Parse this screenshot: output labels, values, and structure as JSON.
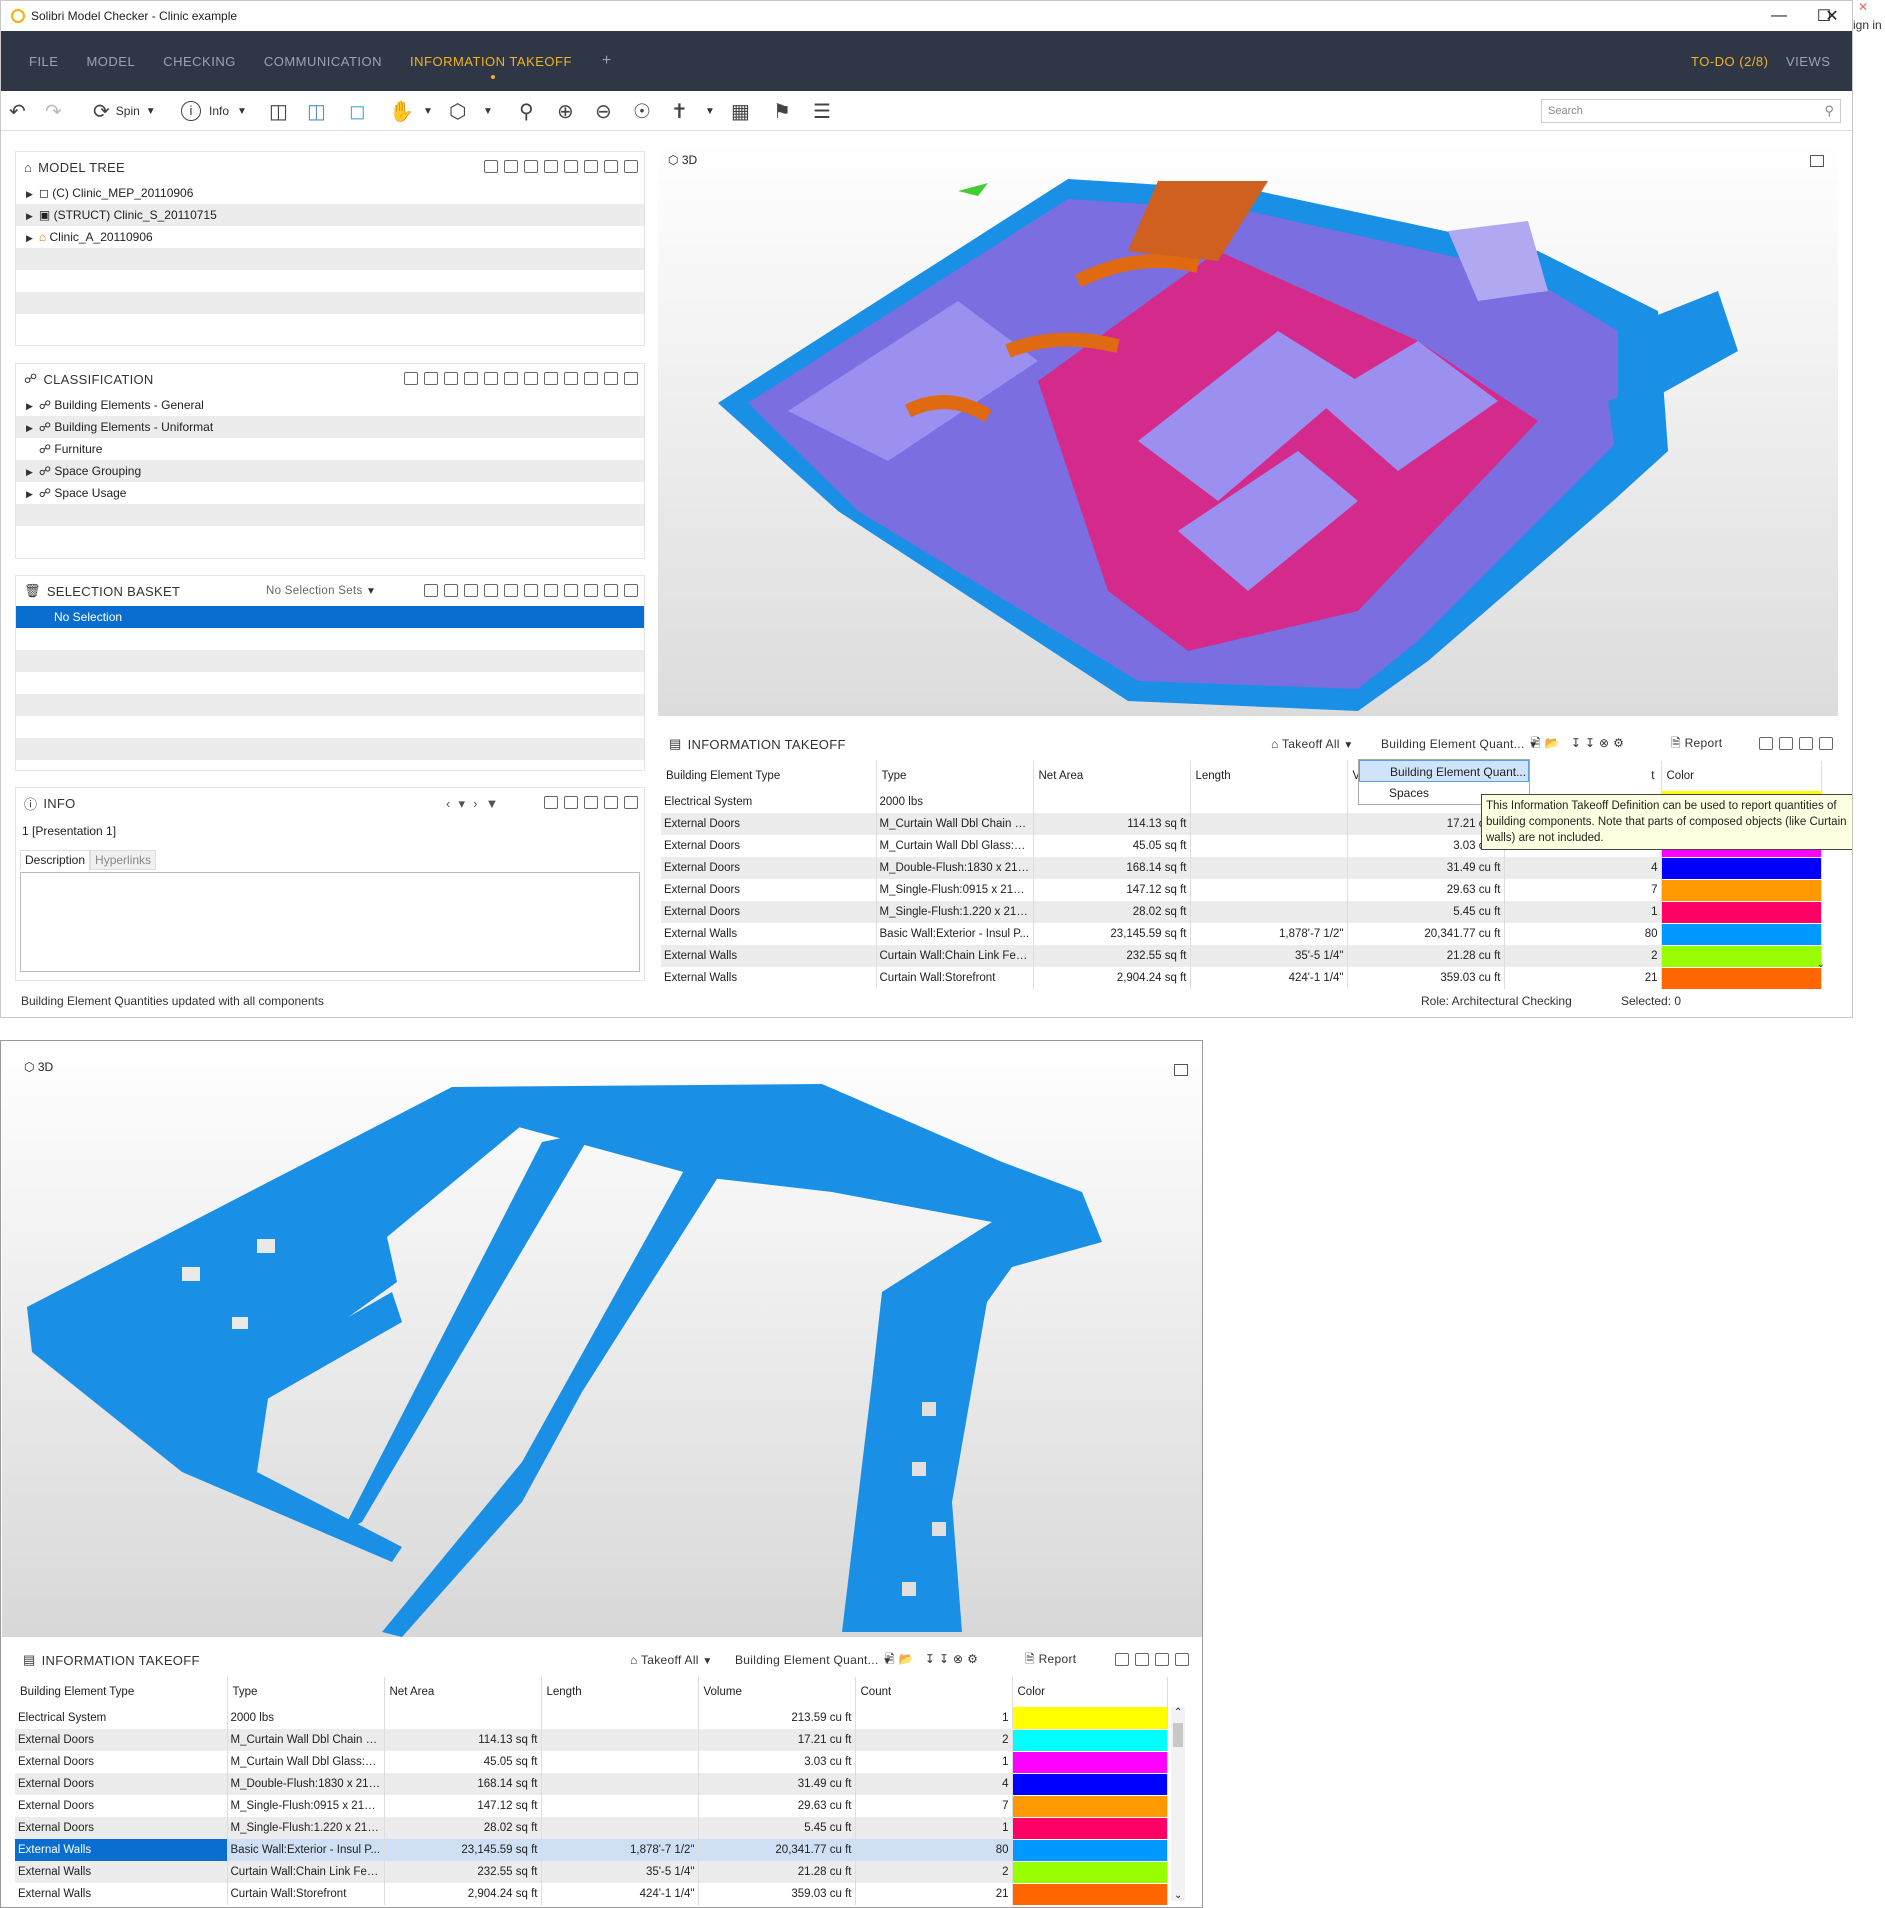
{
  "app": {
    "title": "Solibri Model Checker - Clinic example",
    "sign_in": "ign in"
  },
  "menu": {
    "items": [
      "FILE",
      "MODEL",
      "CHECKING",
      "COMMUNICATION",
      "INFORMATION TAKEOFF"
    ],
    "add": "+",
    "todo": "TO-DO (2/8)",
    "views": "VIEWS"
  },
  "toolbar": {
    "spin": "Spin",
    "info": "Info",
    "search_placeholder": "Search"
  },
  "model_tree": {
    "title": "MODEL TREE",
    "items": [
      "(C) Clinic_MEP_20110906",
      "(STRUCT) Clinic_S_20110715",
      "Clinic_A_20110906"
    ]
  },
  "classification": {
    "title": "CLASSIFICATION",
    "items": [
      "Building Elements - General",
      "Building Elements - Uniformat",
      "Furniture",
      "Space Grouping",
      "Space Usage"
    ]
  },
  "selection_basket": {
    "title": "SELECTION BASKET",
    "sets": "No Selection Sets",
    "selected": "No Selection"
  },
  "info_panel": {
    "title": "INFO",
    "presentation": "1 [Presentation 1]",
    "tab_description": "Description",
    "tab_hyperlinks": "Hyperlinks"
  },
  "view3d": {
    "label": "3D"
  },
  "takeoff": {
    "title": "INFORMATION TAKEOFF",
    "takeoff_all": "Takeoff All",
    "definition": "Building Element Quant...",
    "report": "Report",
    "dropdown_options": [
      "Building Element Quant...",
      "Spaces"
    ],
    "tooltip": "This Information Takeoff Definition can be used to report quantities of building components. Note that parts of composed objects (like Curtain walls) are not included.",
    "columns": [
      "Building Element Type",
      "Type",
      "Net Area",
      "Length",
      "Volume",
      "Count",
      "Color"
    ],
    "partial_volume_header": "V",
    "partial_count_header": "t",
    "rows": [
      {
        "element": "Electrical System",
        "type": "2000 lbs",
        "area": "",
        "length": "",
        "volume": "213.59 cu ft",
        "count": "1",
        "color": "#ffff00"
      },
      {
        "element": "External Doors",
        "type": "M_Curtain Wall Dbl Chain L...",
        "area": "114.13 sq ft",
        "length": "",
        "volume": "17.21 cu ft",
        "count": "2",
        "color": "#00ffff"
      },
      {
        "element": "External Doors",
        "type": "M_Curtain Wall Dbl Glass:M...",
        "area": "45.05 sq ft",
        "length": "",
        "volume": "3.03 cu ft",
        "count": "1",
        "color": "#ff00ff"
      },
      {
        "element": "External Doors",
        "type": "M_Double-Flush:1830 x 213...",
        "area": "168.14 sq ft",
        "length": "",
        "volume": "31.49 cu ft",
        "count": "4",
        "color": "#0000ff"
      },
      {
        "element": "External Doors",
        "type": "M_Single-Flush:0915 x 2134...",
        "area": "147.12 sq ft",
        "length": "",
        "volume": "29.63 cu ft",
        "count": "7",
        "color": "#ff9900"
      },
      {
        "element": "External Doors",
        "type": "M_Single-Flush:1.220 x 213...",
        "area": "28.02 sq ft",
        "length": "",
        "volume": "5.45 cu ft",
        "count": "1",
        "color": "#ff0066"
      },
      {
        "element": "External Walls",
        "type": "Basic Wall:Exterior - Insul P...",
        "area": "23,145.59 sq ft",
        "length": "1,878'-7 1/2\"",
        "volume": "20,341.77 cu ft",
        "count": "80",
        "color": "#0099ff"
      },
      {
        "element": "External Walls",
        "type": "Curtain Wall:Chain Link Fen...",
        "area": "232.55 sq ft",
        "length": "35'-5 1/4\"",
        "volume": "21.28 cu ft",
        "count": "2",
        "color": "#99ff00"
      },
      {
        "element": "External Walls",
        "type": "Curtain Wall:Storefront",
        "area": "2,904.24 sq ft",
        "length": "424'-1 1/4\"",
        "volume": "359.03 cu ft",
        "count": "21",
        "color": "#ff6600"
      }
    ]
  },
  "status": {
    "message": "Building Element Quantities updated with all components",
    "role": "Role: Architectural Checking",
    "selected": "Selected: 0"
  }
}
